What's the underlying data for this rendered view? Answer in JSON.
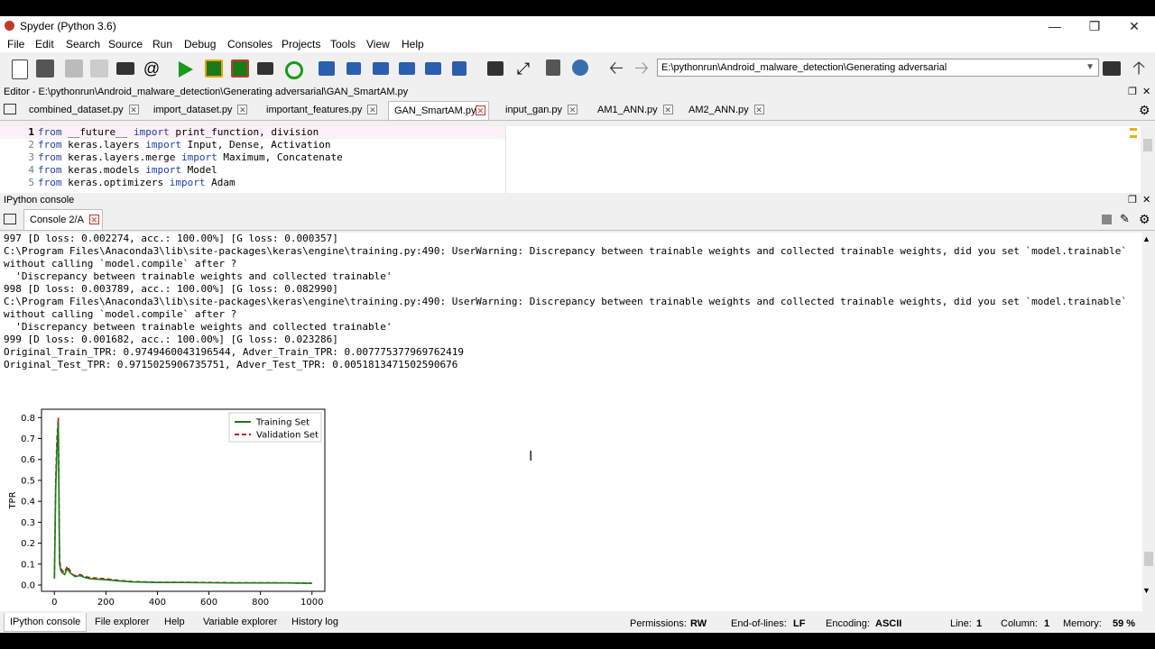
{
  "window": {
    "title": "Spyder (Python 3.6)"
  },
  "menu": [
    "File",
    "Edit",
    "Search",
    "Source",
    "Run",
    "Debug",
    "Consoles",
    "Projects",
    "Tools",
    "View",
    "Help"
  ],
  "toolbar": {
    "path": "E:\\pythonrun\\Android_malware_detection\\Generating adversarial"
  },
  "editor": {
    "header": "Editor - E:\\pythonrun\\Android_malware_detection\\Generating adversarial\\GAN_SmartAM.py",
    "tabs": [
      "combined_dataset.py",
      "import_dataset.py",
      "important_features.py",
      "GAN_SmartAM.py",
      "input_gan.py",
      "AM1_ANN.py",
      "AM2_ANN.py"
    ],
    "active_tab": "GAN_SmartAM.py",
    "lines": [
      {
        "n": "1",
        "kw1": "from",
        "mid": " __future__ ",
        "kw2": "import",
        "rest": " print_function, division"
      },
      {
        "n": "2",
        "kw1": "from",
        "mid": " keras.layers ",
        "kw2": "import",
        "rest": " Input, Dense, Activation"
      },
      {
        "n": "3",
        "kw1": "from",
        "mid": " keras.layers.merge ",
        "kw2": "import",
        "rest": " Maximum, Concatenate"
      },
      {
        "n": "4",
        "kw1": "from",
        "mid": " keras.models ",
        "kw2": "import",
        "rest": " Model"
      },
      {
        "n": "5",
        "kw1": "from",
        "mid": " keras.optimizers ",
        "kw2": "import",
        "rest": " Adam"
      }
    ]
  },
  "console": {
    "header": "IPython console",
    "tab": "Console 2/A",
    "lines": [
      "997 [D loss: 0.002274, acc.: 100.00%] [G loss: 0.000357]",
      "C:\\Program Files\\Anaconda3\\lib\\site-packages\\keras\\engine\\training.py:490: UserWarning: Discrepancy between trainable weights and collected trainable weights, did you set `model.trainable`",
      "without calling `model.compile` after ?",
      "  'Discrepancy between trainable weights and collected trainable'",
      "998 [D loss: 0.003789, acc.: 100.00%] [G loss: 0.082990]",
      "C:\\Program Files\\Anaconda3\\lib\\site-packages\\keras\\engine\\training.py:490: UserWarning: Discrepancy between trainable weights and collected trainable weights, did you set `model.trainable`",
      "without calling `model.compile` after ?",
      "  'Discrepancy between trainable weights and collected trainable'",
      "999 [D loss: 0.001682, acc.: 100.00%] [G loss: 0.023286]",
      "Original_Train_TPR: 0.9749460043196544, Adver_Train_TPR: 0.007775377969762419",
      "Original_Test_TPR: 0.9715025906735751, Adver_Test_TPR: 0.0051813471502590676"
    ]
  },
  "chart_data": {
    "type": "line",
    "title": "",
    "xlabel": "",
    "ylabel": "TPR",
    "xlim": [
      -50,
      1050
    ],
    "ylim": [
      -0.03,
      0.84
    ],
    "xticks": [
      "0",
      "200",
      "400",
      "600",
      "800",
      "1000"
    ],
    "yticks": [
      "0.0",
      "0.1",
      "0.2",
      "0.3",
      "0.4",
      "0.5",
      "0.6",
      "0.7",
      "0.8"
    ],
    "legend_position": "top-right",
    "series": [
      {
        "name": "Training Set",
        "color": "#1a7a1a",
        "style": "solid",
        "x": [
          0,
          5,
          10,
          15,
          20,
          25,
          30,
          40,
          50,
          60,
          70,
          80,
          100,
          120,
          140,
          200,
          250,
          300,
          400,
          500,
          600,
          700,
          800,
          900,
          1000
        ],
        "y": [
          0.03,
          0.45,
          0.65,
          0.78,
          0.1,
          0.07,
          0.06,
          0.05,
          0.08,
          0.06,
          0.05,
          0.04,
          0.045,
          0.035,
          0.03,
          0.025,
          0.02,
          0.015,
          0.012,
          0.012,
          0.011,
          0.01,
          0.01,
          0.01,
          0.008
        ]
      },
      {
        "name": "Validation Set",
        "color": "#cc1111",
        "style": "dashed",
        "x": [
          0,
          5,
          10,
          15,
          20,
          25,
          30,
          40,
          50,
          60,
          70,
          80,
          100,
          120,
          140,
          200,
          250,
          300,
          400,
          500,
          600,
          700,
          800,
          900,
          1000
        ],
        "y": [
          0.04,
          0.5,
          0.7,
          0.8,
          0.12,
          0.08,
          0.07,
          0.06,
          0.09,
          0.07,
          0.05,
          0.045,
          0.05,
          0.04,
          0.035,
          0.03,
          0.022,
          0.017,
          0.013,
          0.013,
          0.012,
          0.011,
          0.011,
          0.01,
          0.009
        ]
      }
    ]
  },
  "bottom_tabs": [
    "IPython console",
    "File explorer",
    "Help",
    "Variable explorer",
    "History log"
  ],
  "status": {
    "permissions_label": "Permissions:",
    "permissions": "RW",
    "eol_label": "End-of-lines:",
    "eol": "LF",
    "encoding_label": "Encoding:",
    "encoding": "ASCII",
    "line_label": "Line:",
    "line": "1",
    "column_label": "Column:",
    "column": "1",
    "memory_label": "Memory:",
    "memory": "59 %"
  }
}
